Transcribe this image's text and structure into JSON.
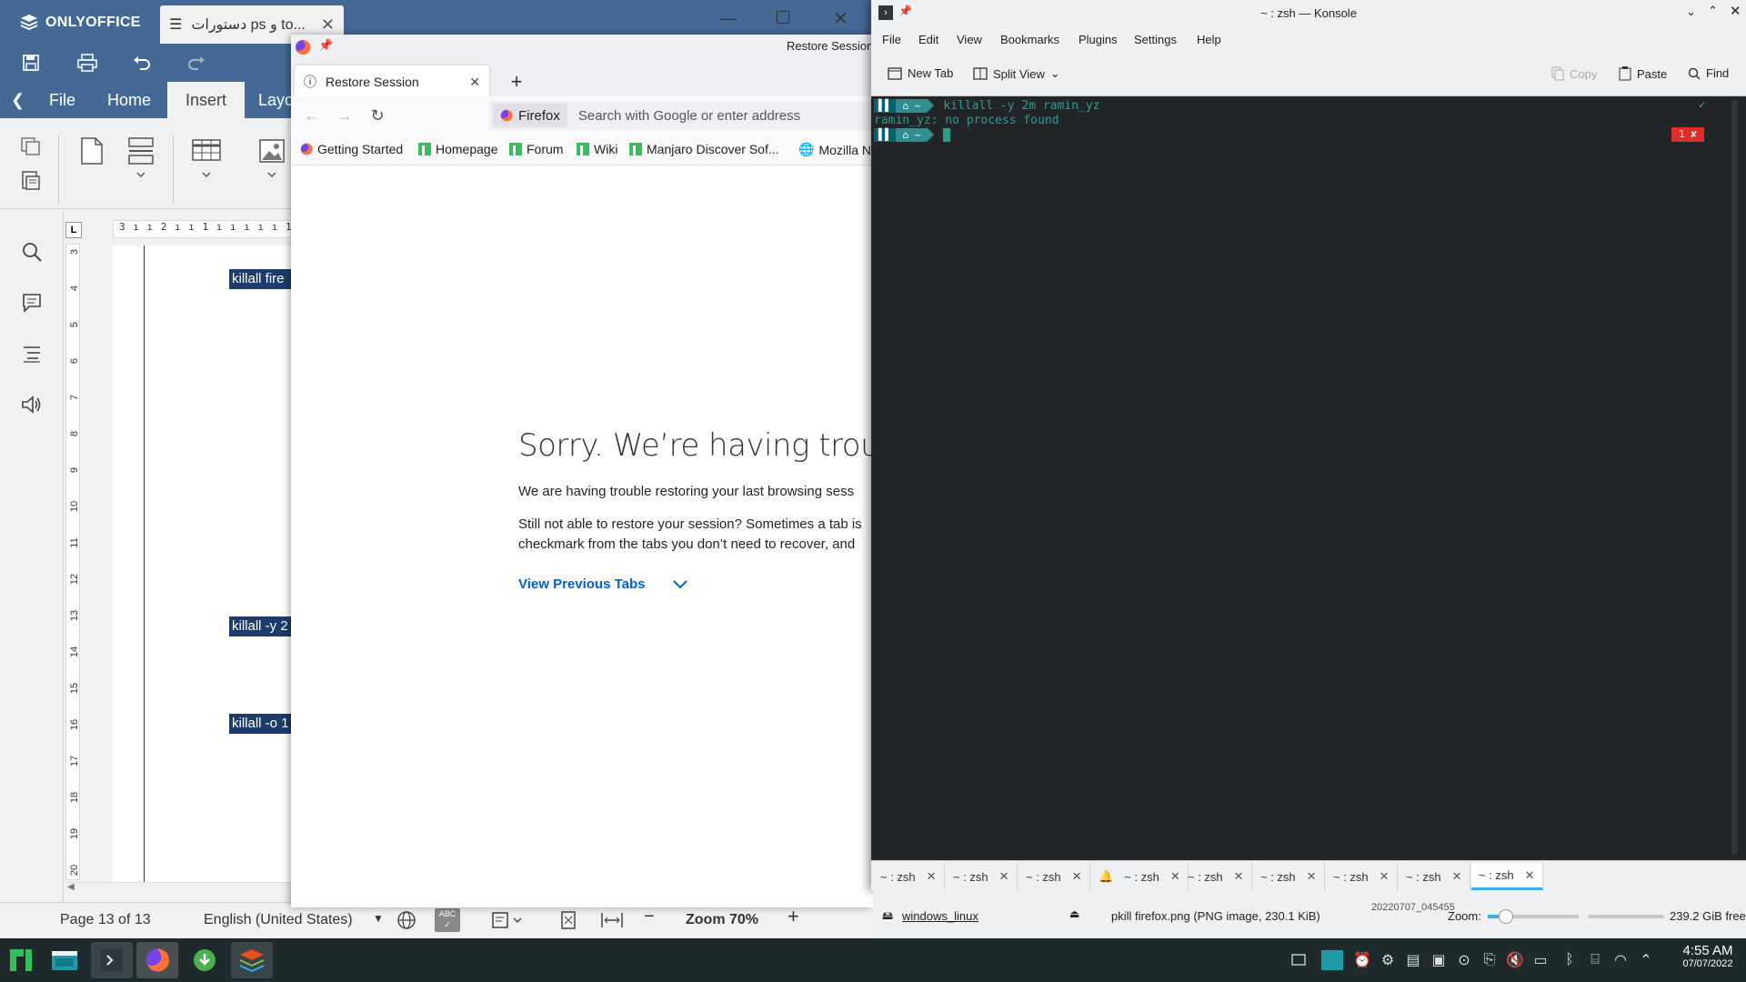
{
  "onlyoffice": {
    "app_name": "ONLYOFFICE",
    "doc_tab_title": "دستورات ps و to...",
    "menu_tabs": [
      "File",
      "Home",
      "Insert",
      "Layo"
    ],
    "active_tab": "Insert",
    "ruler_h": "3 ı ı 2 ı ı 1 ı ı ı ı ı 1 ı",
    "ruler_v_numbers": [
      "3",
      "4",
      "5",
      "6",
      "7",
      "8",
      "9",
      "10",
      "11",
      "12",
      "13",
      "14",
      "15",
      "16",
      "17",
      "18",
      "19",
      "20"
    ],
    "doc_lines": [
      "killall fire",
      "killall -y 2",
      "killall -o 1"
    ],
    "status": {
      "page": "Page 13 of 13",
      "language": "English (United States)",
      "zoom": "Zoom 70%"
    }
  },
  "firefox": {
    "window_title": "Restore Session -",
    "tab_title": "Restore Session",
    "url_identity": "Firefox",
    "url_placeholder": "Search with Google or enter address",
    "bookmarks": [
      "Getting Started",
      "Homepage",
      "Forum",
      "Wiki",
      "Manjaro Discover Sof...",
      "Mozilla Ne"
    ],
    "heading": "Sorry. We’re having trouble",
    "para1": "We are having trouble restoring your last browsing sess",
    "para2_line1": "Still not able to restore your session? Sometimes a tab is",
    "para2_line2": "checkmark from the tabs you don’t need to recover, and",
    "view_previous": "View Previous Tabs"
  },
  "konsole": {
    "window_title": "~ : zsh — Konsole",
    "menu": [
      "File",
      "Edit",
      "View",
      "Bookmarks",
      "Plugins",
      "Settings",
      "Help"
    ],
    "toolbar": {
      "new_tab": "New Tab",
      "split_view": "Split View",
      "copy": "Copy",
      "paste": "Paste",
      "find": "Find"
    },
    "prompt_dir": "~",
    "command1": "killall -y 2m ramin_yz",
    "output1": "ramin_yz: no process found",
    "status_ok": "✓",
    "status_err": "1 ✘",
    "tabs": [
      "~ : zsh",
      "~ : zsh",
      "~ : zsh",
      "~ : zsh",
      "~ : zsh",
      "~ : zsh",
      "~ : zsh",
      "~ : zsh",
      "~ : zsh"
    ],
    "active_tab_index": 8
  },
  "dolphin": {
    "device": "windows_linux",
    "file_info": "pkill firefox.png (PNG image, 230.1 KiB)",
    "zoom_label": "Zoom:",
    "free_space": "239.2 GiB free",
    "partial_name": "20220707_045455"
  },
  "taskbar": {
    "time": "4:55 AM",
    "date": "07/07/2022"
  },
  "colors": {
    "onlyoffice_blue": "#446995",
    "konsole_bg": "#232629",
    "prompt_teal": "#2f8f8f",
    "link_blue": "#0060df",
    "error_red": "#e02b2b"
  }
}
